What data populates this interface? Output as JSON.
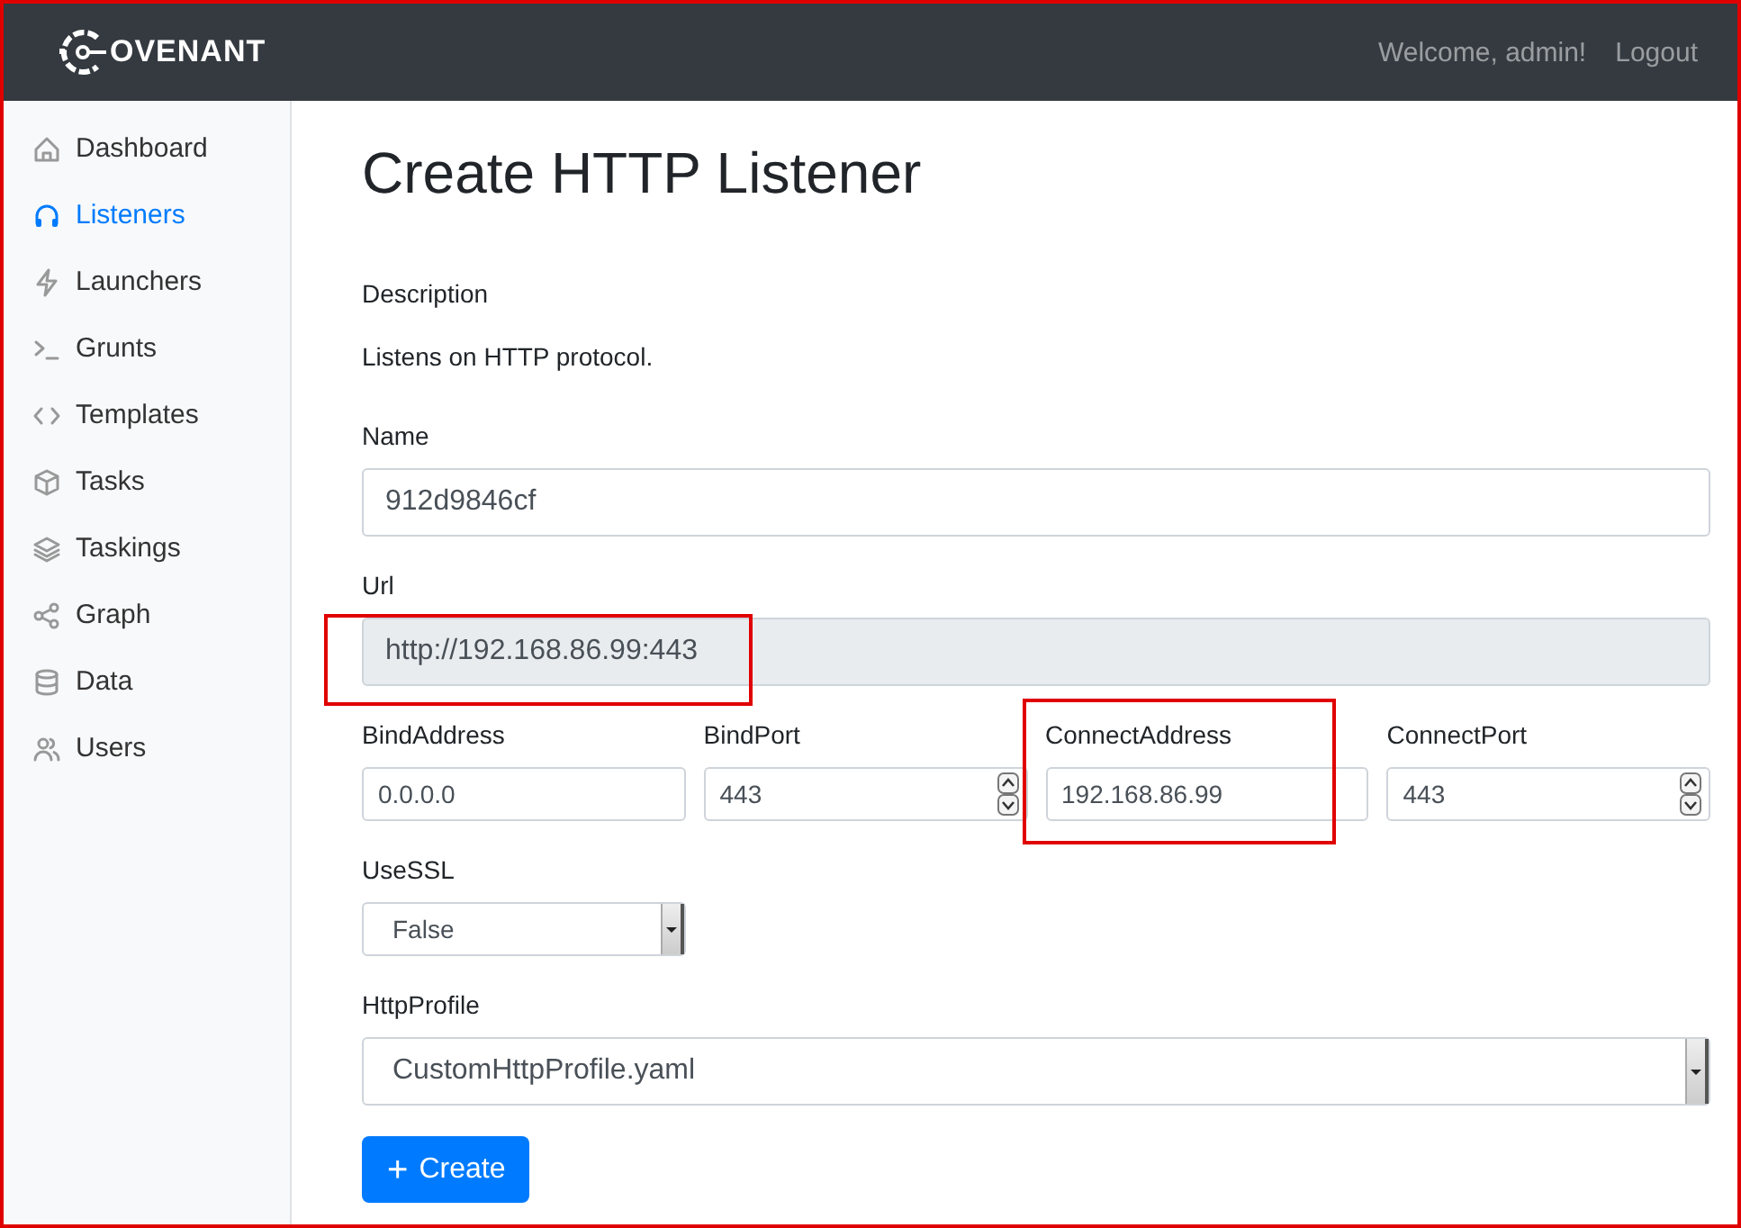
{
  "navbar": {
    "brand": "OVENANT",
    "welcome": "Welcome, admin!",
    "logout": "Logout"
  },
  "sidebar": {
    "items": [
      {
        "label": "Dashboard",
        "selected": false
      },
      {
        "label": "Listeners",
        "selected": true
      },
      {
        "label": "Launchers",
        "selected": false
      },
      {
        "label": "Grunts",
        "selected": false
      },
      {
        "label": "Templates",
        "selected": false
      },
      {
        "label": "Tasks",
        "selected": false
      },
      {
        "label": "Taskings",
        "selected": false
      },
      {
        "label": "Graph",
        "selected": false
      },
      {
        "label": "Data",
        "selected": false
      },
      {
        "label": "Users",
        "selected": false
      }
    ]
  },
  "page": {
    "title": "Create HTTP Listener",
    "description_label": "Description",
    "description": "Listens on HTTP protocol."
  },
  "rows": [
    {
      "compact": false,
      "fields": [
        {
          "label": "Name",
          "kind": "text",
          "value": "912d9846cf",
          "disabled": false,
          "highlighted": false
        }
      ]
    },
    {
      "compact": false,
      "fields": [
        {
          "label": "Url",
          "kind": "text",
          "value": "http://192.168.86.99:443",
          "disabled": true,
          "highlighted": true
        }
      ]
    },
    {
      "compact": true,
      "fields": [
        {
          "label": "BindAddress",
          "kind": "text",
          "value": "0.0.0.0",
          "disabled": false,
          "highlighted": false
        },
        {
          "label": "BindPort",
          "kind": "number",
          "value": "443",
          "disabled": false,
          "highlighted": false
        },
        {
          "label": "ConnectAddress",
          "kind": "text",
          "value": "192.168.86.99",
          "disabled": false,
          "highlighted": true
        },
        {
          "label": "ConnectPort",
          "kind": "number",
          "value": "443",
          "disabled": false,
          "highlighted": false
        }
      ]
    },
    {
      "compact": true,
      "fields": [
        {
          "label": "UseSSL",
          "kind": "select",
          "value": "False",
          "disabled": false,
          "highlighted": false
        }
      ]
    },
    {
      "compact": false,
      "fields": [
        {
          "label": "HttpProfile",
          "kind": "select",
          "value": "CustomHttpProfile.yaml",
          "disabled": false,
          "highlighted": false
        }
      ]
    }
  ],
  "create_button": {
    "icon": "+",
    "label": "Create"
  }
}
